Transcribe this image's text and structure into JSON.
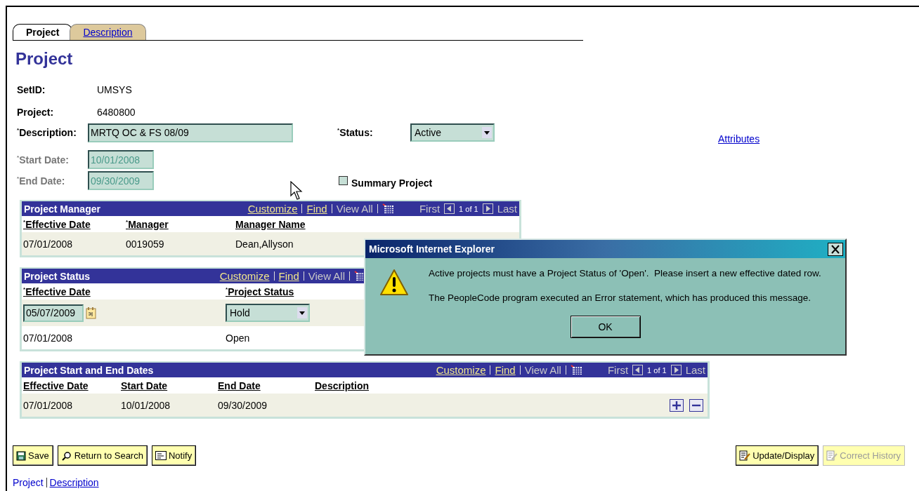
{
  "tabs": [
    {
      "label": "Project",
      "selected": true
    },
    {
      "label": "Description",
      "selected": false
    }
  ],
  "page_title": "Project",
  "fields": {
    "setid": {
      "label": "SetID:",
      "value": "UMSYS"
    },
    "project": {
      "label": "Project:",
      "value": "6480800"
    },
    "description": {
      "label": "$^{*}$Description:",
      "value": "MRTQ OC & FS 08/09"
    },
    "status": {
      "label": "$^{*}$Status:",
      "value": "Active"
    },
    "attributes_link": "Attributes",
    "start_date": {
      "label": "$^{*}$Start Date:",
      "value": "10/01/2008",
      "disabled": true
    },
    "end_date": {
      "label": "$^{*}$End Date:",
      "value": "09/30/2009",
      "disabled": true
    },
    "summary_project": {
      "label": "Summary Project",
      "checked": false
    }
  },
  "grids": [
    {
      "title": "Project Manager",
      "nav": {
        "links": [
          "Customize",
          "Find"
        ],
        "view_all": "View All",
        "first": "First",
        "count": "1 of 1",
        "last": "Last"
      },
      "columns": [
        "$^{*}$Effective Date",
        "$^{*}$Manager",
        "Manager Name"
      ],
      "rows": [
        [
          {
            "kind": "text",
            "value": "07/01/2008"
          },
          {
            "kind": "text",
            "value": "0019059"
          },
          {
            "kind": "text",
            "value": "Dean,Allyson"
          }
        ]
      ]
    },
    {
      "title": "Project Status",
      "nav": {
        "links": [
          "Customize",
          "Find"
        ],
        "view_all": "View All"
      },
      "columns": [
        "$^{*}$Effective Date",
        "$^{*}$Project Status"
      ],
      "rows": [
        [
          {
            "kind": "date_input",
            "value": "05/07/2009"
          },
          {
            "kind": "select",
            "value": "Hold"
          }
        ],
        [
          {
            "kind": "text",
            "value": "07/01/2008"
          },
          {
            "kind": "text",
            "value": "Open"
          }
        ]
      ]
    },
    {
      "title": "Project Start and End Dates",
      "nav": {
        "links": [
          "Customize",
          "Find"
        ],
        "view_all": "View All",
        "first": "First",
        "count": "1 of 1",
        "last": "Last"
      },
      "columns": [
        "Effective Date",
        "Start Date",
        "End Date",
        "Description"
      ],
      "rows": [
        [
          {
            "kind": "text",
            "value": "07/01/2008"
          },
          {
            "kind": "text",
            "value": "10/01/2008"
          },
          {
            "kind": "text",
            "value": "09/30/2009"
          }
        ]
      ],
      "row_controls": true
    }
  ],
  "dialog": {
    "title": "Microsoft Internet Explorer",
    "messages": [
      "Active projects must have a Project Status of 'Open'.  Please insert a new effective dated row.",
      "The PeopleCode program executed an Error statement, which has produced this message."
    ],
    "button": "OK"
  },
  "buttons_left": [
    {
      "kind": "save",
      "label": "Save",
      "disabled": false
    },
    {
      "kind": "search",
      "label": "Return to Search",
      "disabled": false
    },
    {
      "kind": "notify",
      "label": "Notify",
      "disabled": false
    }
  ],
  "buttons_right": [
    {
      "kind": "update",
      "label": "Update/Display",
      "disabled": false
    },
    {
      "kind": "history",
      "label": "Correct History",
      "disabled": true
    }
  ],
  "footer_links": [
    {
      "label": "Project",
      "current": true
    },
    {
      "label": "Description",
      "current": false
    }
  ]
}
